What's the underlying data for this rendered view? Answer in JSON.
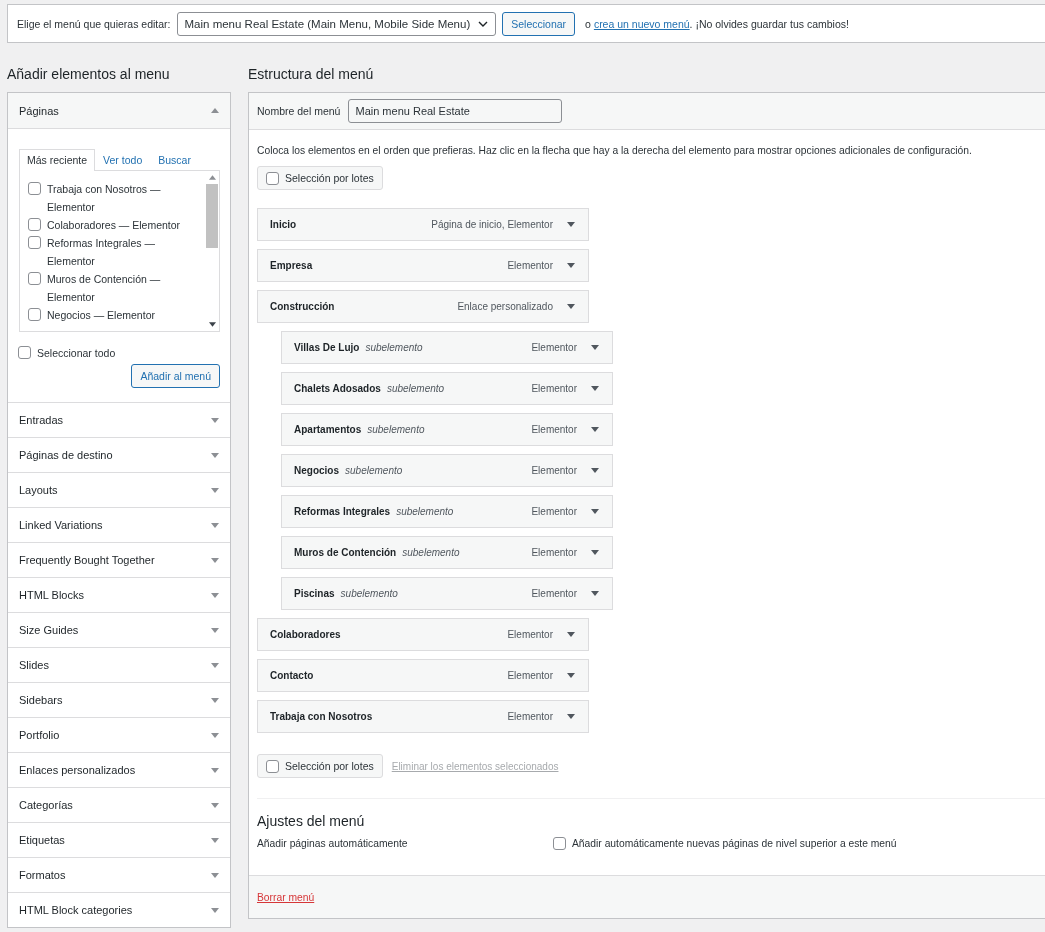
{
  "menu_picker": {
    "label": "Elige el menú que quieras editar:",
    "value": "Main menu Real Estate (Main Menu, Mobile Side Menu)",
    "button": "Seleccionar",
    "or_text": "o",
    "create_link": "crea un nuevo menú",
    "reminder": ". ¡No olvides guardar tus cambios!"
  },
  "add_items": {
    "title": "Añadir elementos al menu",
    "sections": [
      {
        "title": "Páginas",
        "expanded": true,
        "tabs": [
          {
            "label": "Más reciente",
            "selected": true
          },
          {
            "label": "Ver todo",
            "selected": false
          },
          {
            "label": "Buscar",
            "selected": false
          }
        ],
        "pages": [
          {
            "label": "Trabaja con Nosotros — Elementor",
            "checked": false
          },
          {
            "label": "Colaboradores — Elementor",
            "checked": false
          },
          {
            "label": "Reformas Integrales — Elementor",
            "checked": false
          },
          {
            "label": "Muros de Contención — Elementor",
            "checked": false
          },
          {
            "label": "Negocios — Elementor",
            "checked": false
          }
        ],
        "select_all": {
          "label": "Seleccionar todo",
          "checked": false
        },
        "add_button": "Añadir al menú"
      },
      {
        "title": "Entradas",
        "expanded": false
      },
      {
        "title": "Páginas de destino",
        "expanded": false
      },
      {
        "title": "Layouts",
        "expanded": false
      },
      {
        "title": "Linked Variations",
        "expanded": false
      },
      {
        "title": "Frequently Bought Together",
        "expanded": false
      },
      {
        "title": "HTML Blocks",
        "expanded": false
      },
      {
        "title": "Size Guides",
        "expanded": false
      },
      {
        "title": "Slides",
        "expanded": false
      },
      {
        "title": "Sidebars",
        "expanded": false
      },
      {
        "title": "Portfolio",
        "expanded": false
      },
      {
        "title": "Enlaces personalizados",
        "expanded": false
      },
      {
        "title": "Categorías",
        "expanded": false
      },
      {
        "title": "Etiquetas",
        "expanded": false
      },
      {
        "title": "Formatos",
        "expanded": false
      },
      {
        "title": "HTML Block categories",
        "expanded": false
      }
    ]
  },
  "structure": {
    "title": "Estructura del menú",
    "name_label": "Nombre del menú",
    "name_value": "Main menu Real Estate",
    "instructions": "Coloca los elementos en el orden que prefieras. Haz clic en la flecha que hay a la derecha del elemento para mostrar opciones adicionales de configuración.",
    "bulk_top": {
      "label": "Selección por lotes",
      "checked": false
    },
    "items": [
      {
        "title": "Inicio",
        "type": "Página de inicio, Elementor"
      },
      {
        "title": "Empresa",
        "type": "Elementor"
      },
      {
        "title": "Construcción",
        "type": "Enlace personalizado",
        "children": [
          {
            "title": "Villas De Lujo",
            "sub": "subelemento",
            "type": "Elementor"
          },
          {
            "title": "Chalets Adosados",
            "sub": "subelemento",
            "type": "Elementor"
          },
          {
            "title": "Apartamentos",
            "sub": "subelemento",
            "type": "Elementor"
          },
          {
            "title": "Negocios",
            "sub": "subelemento",
            "type": "Elementor"
          },
          {
            "title": "Reformas Integrales",
            "sub": "subelemento",
            "type": "Elementor"
          },
          {
            "title": "Muros de Contención",
            "sub": "subelemento",
            "type": "Elementor"
          },
          {
            "title": "Piscinas",
            "sub": "subelemento",
            "type": "Elementor"
          }
        ]
      },
      {
        "title": "Colaboradores",
        "type": "Elementor"
      },
      {
        "title": "Contacto",
        "type": "Elementor"
      },
      {
        "title": "Trabaja con Nosotros",
        "type": "Elementor"
      }
    ],
    "bulk_bottom": {
      "label": "Selección por lotes",
      "checked": false
    },
    "remove_link": "Eliminar los elementos seleccionados",
    "settings_title": "Ajustes del menú",
    "auto_add_label": "Añadir páginas automáticamente",
    "auto_add": {
      "label": "Añadir automáticamente nuevas páginas de nivel superior a este menú",
      "checked": false
    },
    "delete_link": "Borrar menú"
  }
}
